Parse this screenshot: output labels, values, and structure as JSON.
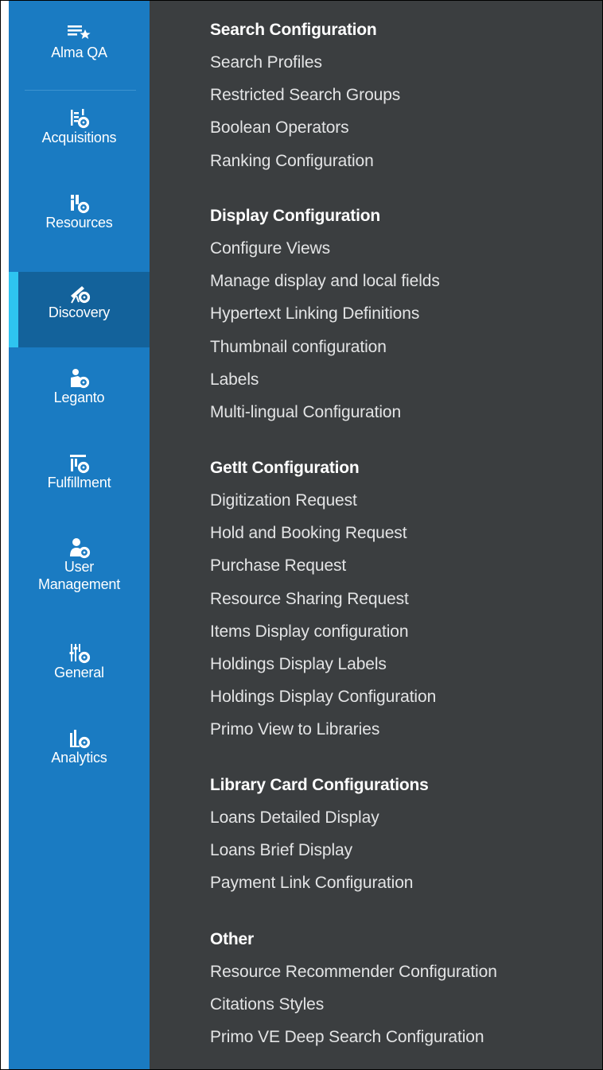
{
  "sidebar": {
    "items": [
      {
        "label": "Alma QA",
        "icon": "list-star-icon"
      },
      {
        "label": "Acquisitions",
        "icon": "acquisitions-gear-icon"
      },
      {
        "label": "Resources",
        "icon": "resources-gear-icon"
      },
      {
        "label": "Discovery",
        "icon": "telescope-gear-icon",
        "active": true
      },
      {
        "label": "Leganto",
        "icon": "leganto-gear-icon"
      },
      {
        "label": "Fulfillment",
        "icon": "fulfillment-gear-icon"
      },
      {
        "label": "User\nManagement",
        "icon": "user-gear-icon"
      },
      {
        "label": "General",
        "icon": "sliders-gear-icon"
      },
      {
        "label": "Analytics",
        "icon": "chart-gear-icon"
      }
    ],
    "accent_color": "#2ec4f0",
    "background_color": "#1a7bc2"
  },
  "menu": {
    "groups": [
      {
        "heading": "Search Configuration",
        "links": [
          "Search Profiles",
          "Restricted Search Groups",
          "Boolean Operators",
          "Ranking Configuration"
        ]
      },
      {
        "heading": "Display Configuration",
        "links": [
          "Configure Views",
          "Manage display and local fields",
          "Hypertext Linking Definitions",
          "Thumbnail configuration",
          "Labels",
          "Multi-lingual Configuration"
        ]
      },
      {
        "heading": "GetIt Configuration",
        "links": [
          "Digitization Request",
          "Hold and Booking Request",
          "Purchase Request",
          "Resource Sharing Request",
          "Items Display configuration",
          "Holdings Display Labels",
          "Holdings Display Configuration",
          "Primo View to Libraries"
        ]
      },
      {
        "heading": "Library Card Configurations",
        "links": [
          "Loans Detailed Display",
          "Loans Brief Display",
          "Payment Link Configuration"
        ]
      },
      {
        "heading": "Other",
        "links": [
          "Resource Recommender Configuration",
          "Citations Styles",
          "Primo VE Deep Search Configuration"
        ]
      }
    ]
  }
}
